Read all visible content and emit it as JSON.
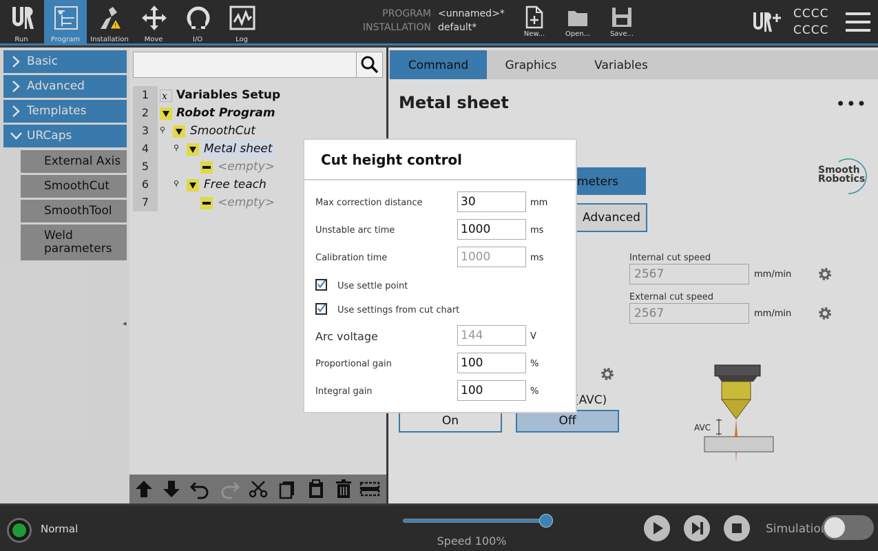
{
  "topbar": {
    "nav": [
      {
        "label": "Run",
        "icon": "ur-logo-icon"
      },
      {
        "label": "Program",
        "icon": "program-icon"
      },
      {
        "label": "Installation",
        "icon": "installation-warning-icon"
      },
      {
        "label": "Move",
        "icon": "move-arrows-icon"
      },
      {
        "label": "I/O",
        "icon": "io-icon"
      },
      {
        "label": "Log",
        "icon": "log-chart-icon"
      }
    ],
    "program_key": "PROGRAM",
    "program_value": "<unnamed>*",
    "installation_key": "INSTALLATION",
    "installation_value": "default*",
    "file_buttons": [
      {
        "label": "New...",
        "icon": "new-file-icon"
      },
      {
        "label": "Open...",
        "icon": "open-folder-icon"
      },
      {
        "label": "Save...",
        "icon": "save-disk-icon"
      }
    ],
    "ur_plus_icon": "ur-plus-icon",
    "user_line1": "CCCC",
    "user_line2": "CCCC",
    "menu_icon": "hamburger-menu-icon"
  },
  "sidebar": {
    "categories": [
      {
        "label": "Basic",
        "expanded": false
      },
      {
        "label": "Advanced",
        "expanded": false
      },
      {
        "label": "Templates",
        "expanded": false
      },
      {
        "label": "URCaps",
        "expanded": true
      }
    ],
    "urcaps_items": [
      "External Axis",
      "SmoothCut",
      "SmoothTool",
      "Weld\nparameters"
    ]
  },
  "tree": {
    "search_placeholder": "",
    "lines": [
      {
        "num": "1",
        "label": "Variables Setup",
        "style": "bold",
        "icon": "variables-x-icon"
      },
      {
        "num": "2",
        "label": "Robot Program",
        "style": "bold-italic",
        "icon": "expand-triangle-icon"
      },
      {
        "num": "3",
        "label": "SmoothCut",
        "style": "italic",
        "icon": "expand-triangle-icon"
      },
      {
        "num": "4",
        "label": "Metal sheet",
        "style": "italic-selected",
        "icon": "expand-triangle-icon"
      },
      {
        "num": "5",
        "label": "<empty>",
        "style": "italic-gray",
        "icon": "empty-node-icon"
      },
      {
        "num": "6",
        "label": "Free teach",
        "style": "italic",
        "icon": "expand-triangle-icon"
      },
      {
        "num": "7",
        "label": "<empty>",
        "style": "italic-gray",
        "icon": "empty-node-icon"
      }
    ],
    "toolbar_icons": [
      "move-up-icon",
      "move-down-icon",
      "undo-icon",
      "redo-icon",
      "cut-scissors-icon",
      "copy-icon",
      "paste-icon",
      "delete-trash-icon",
      "suppress-icon"
    ]
  },
  "right": {
    "tabs": [
      "Command",
      "Graphics",
      "Variables"
    ],
    "active_tab": "Command",
    "node_title": "Metal sheet",
    "more_label": "•••",
    "params_tab_label": "meters",
    "advanced_label": "Advanced",
    "logo_line1": "Smooth",
    "logo_line2": "Robotics",
    "internal_speed_label": "Internal cut speed",
    "internal_speed_value": "2567",
    "external_speed_label": "External cut speed",
    "external_speed_value": "2567",
    "speed_unit": "mm/min",
    "avc_partial_label": "(AVC)",
    "on_label": "On",
    "off_label": "Off",
    "torch_label": "AVC"
  },
  "dialog": {
    "title": "Cut height control",
    "rows": [
      {
        "label": "Max correction distance",
        "value": "30",
        "unit": "mm",
        "disabled": false
      },
      {
        "label": "Unstable arc time",
        "value": "1000",
        "unit": "ms",
        "disabled": false
      },
      {
        "label": "Calibration time",
        "value": "1000",
        "unit": "ms",
        "disabled": true
      }
    ],
    "checkboxes": [
      {
        "label": "Use settle point",
        "checked": true
      },
      {
        "label": "Use settings from cut chart",
        "checked": true
      }
    ],
    "rows2": [
      {
        "label": "Arc voltage",
        "value": "144",
        "unit": "V",
        "disabled": true
      },
      {
        "label": "Proportional gain",
        "value": "100",
        "unit": "%",
        "disabled": false
      },
      {
        "label": "Integral gain",
        "value": "100",
        "unit": "%",
        "disabled": false
      }
    ]
  },
  "footer": {
    "status": "Normal",
    "speed_fraction": 1.0,
    "speed_text": "Speed 100%",
    "play_icon": "play-icon",
    "step_icon": "step-forward-icon",
    "stop_icon": "stop-icon",
    "simulation_label": "Simulation",
    "simulation_on": false
  },
  "colors": {
    "accent": "#3d80b5",
    "topbar": "#2b2b2b",
    "highlight": "#dbe6f3",
    "status_green": "#1f9a3a"
  }
}
